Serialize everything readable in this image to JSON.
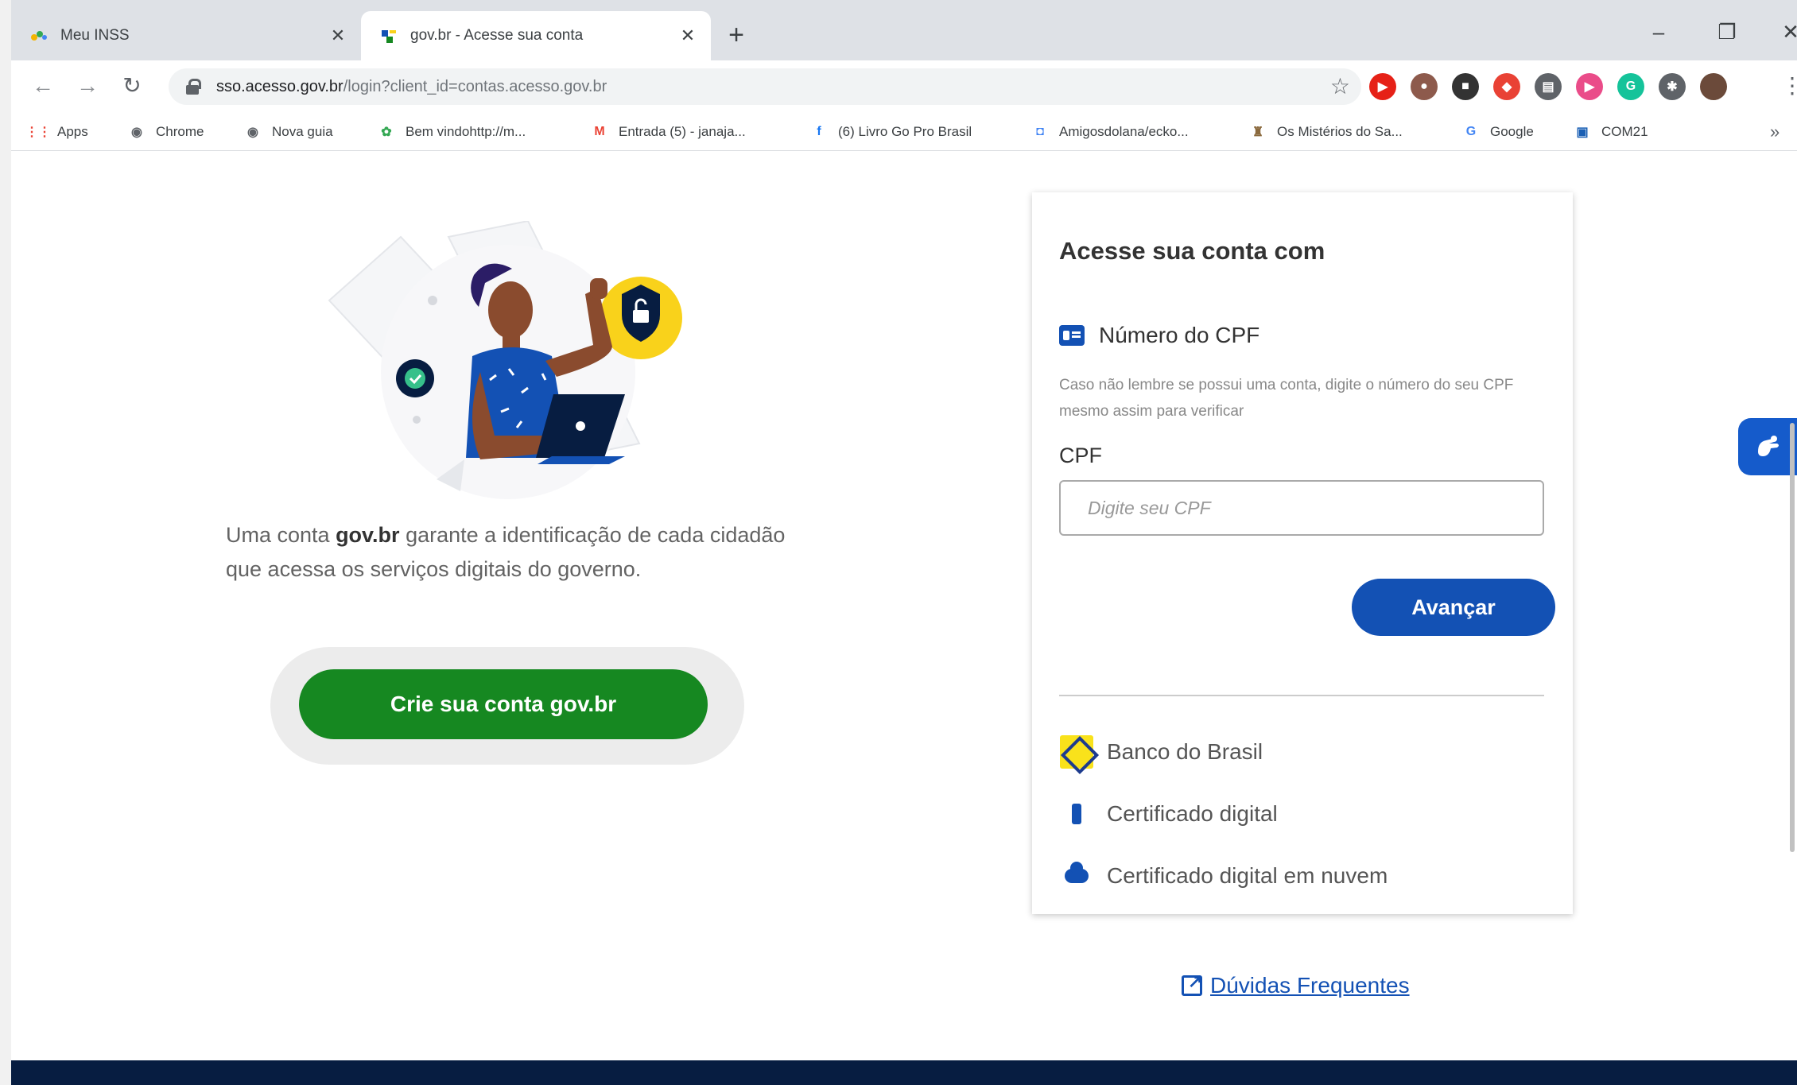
{
  "browser": {
    "tabs": [
      {
        "title": "Meu INSS",
        "close": "✕"
      },
      {
        "title": "gov.br - Acesse sua conta",
        "close": "✕"
      }
    ],
    "new_tab": "+",
    "window_controls": {
      "minimize": "–",
      "restore": "❐",
      "close": "✕"
    },
    "nav": {
      "back": "←",
      "forward": "→",
      "reload": "↻"
    },
    "url_host": "sso.acesso.gov.br",
    "url_path": "/login?client_id=contas.acesso.gov.br",
    "star": "☆",
    "extensions": [
      {
        "name": "youtube-extension-icon",
        "color": "#e62117",
        "glyph": "▶"
      },
      {
        "name": "extension-icon-brown",
        "color": "#8d5a4c",
        "glyph": "●"
      },
      {
        "name": "extension-icon-square",
        "color": "#333333",
        "glyph": "■"
      },
      {
        "name": "extension-icon-multicolor",
        "color": "#e94235",
        "glyph": "◆"
      },
      {
        "name": "extension-icon-cast",
        "color": "#5f6368",
        "glyph": "▤"
      },
      {
        "name": "extension-icon-play",
        "color": "#ea4c89",
        "glyph": "▶"
      },
      {
        "name": "grammarly-extension-icon",
        "color": "#15c39a",
        "glyph": "G"
      },
      {
        "name": "extensions-puzzle-icon",
        "color": "#5f6368",
        "glyph": "✱"
      },
      {
        "name": "profile-avatar",
        "color": "#6b4a3a",
        "glyph": ""
      }
    ],
    "menu": "⋮"
  },
  "bookmarks": [
    {
      "label": "Apps",
      "glyph": "⋮⋮",
      "color": "#ea4335"
    },
    {
      "label": "Chrome",
      "glyph": "◉",
      "color": "#5f6368"
    },
    {
      "label": "Nova guia",
      "glyph": "◉",
      "color": "#5f6368"
    },
    {
      "label": "Bem vindohttp://m...",
      "glyph": "✿",
      "color": "#34a853"
    },
    {
      "label": "Entrada (5) - janaja...",
      "glyph": "M",
      "color": "#ea4335"
    },
    {
      "label": "(6) Livro Go Pro Brasil",
      "glyph": "f",
      "color": "#1877f2"
    },
    {
      "label": "Amigosdolana/ecko...",
      "glyph": "◘",
      "color": "#4285f4"
    },
    {
      "label": "Os Mistérios do Sa...",
      "glyph": "♜",
      "color": "#8b6a3e"
    },
    {
      "label": "Google",
      "glyph": "G",
      "color": "#4285f4"
    },
    {
      "label": "COM21",
      "glyph": "▣",
      "color": "#1a5fb4"
    }
  ],
  "bookmarks_more": "»",
  "page": {
    "lead_pre": "Uma conta ",
    "lead_brand": "gov.br",
    "lead_post": " garante a identificação de cada cidadão que acessa os serviços digitais do governo.",
    "create_account": "Crie sua conta gov.br",
    "card": {
      "title": "Acesse sua conta com",
      "cpf_option": "Número do CPF",
      "hint": "Caso não lembre se possui uma conta, digite o número do seu CPF mesmo assim para verificar",
      "cpf_label": "CPF",
      "cpf_placeholder": "Digite seu CPF",
      "next": "Avançar",
      "alternatives": [
        "Banco do Brasil",
        "Certificado digital",
        "Certificado digital em nuvem"
      ]
    },
    "faq": "Dúvidas Frequentes"
  },
  "colors": {
    "gov_blue": "#1351b4",
    "gov_green": "#168821",
    "footer": "#071d41",
    "shield_yellow": "#f9d21b"
  }
}
